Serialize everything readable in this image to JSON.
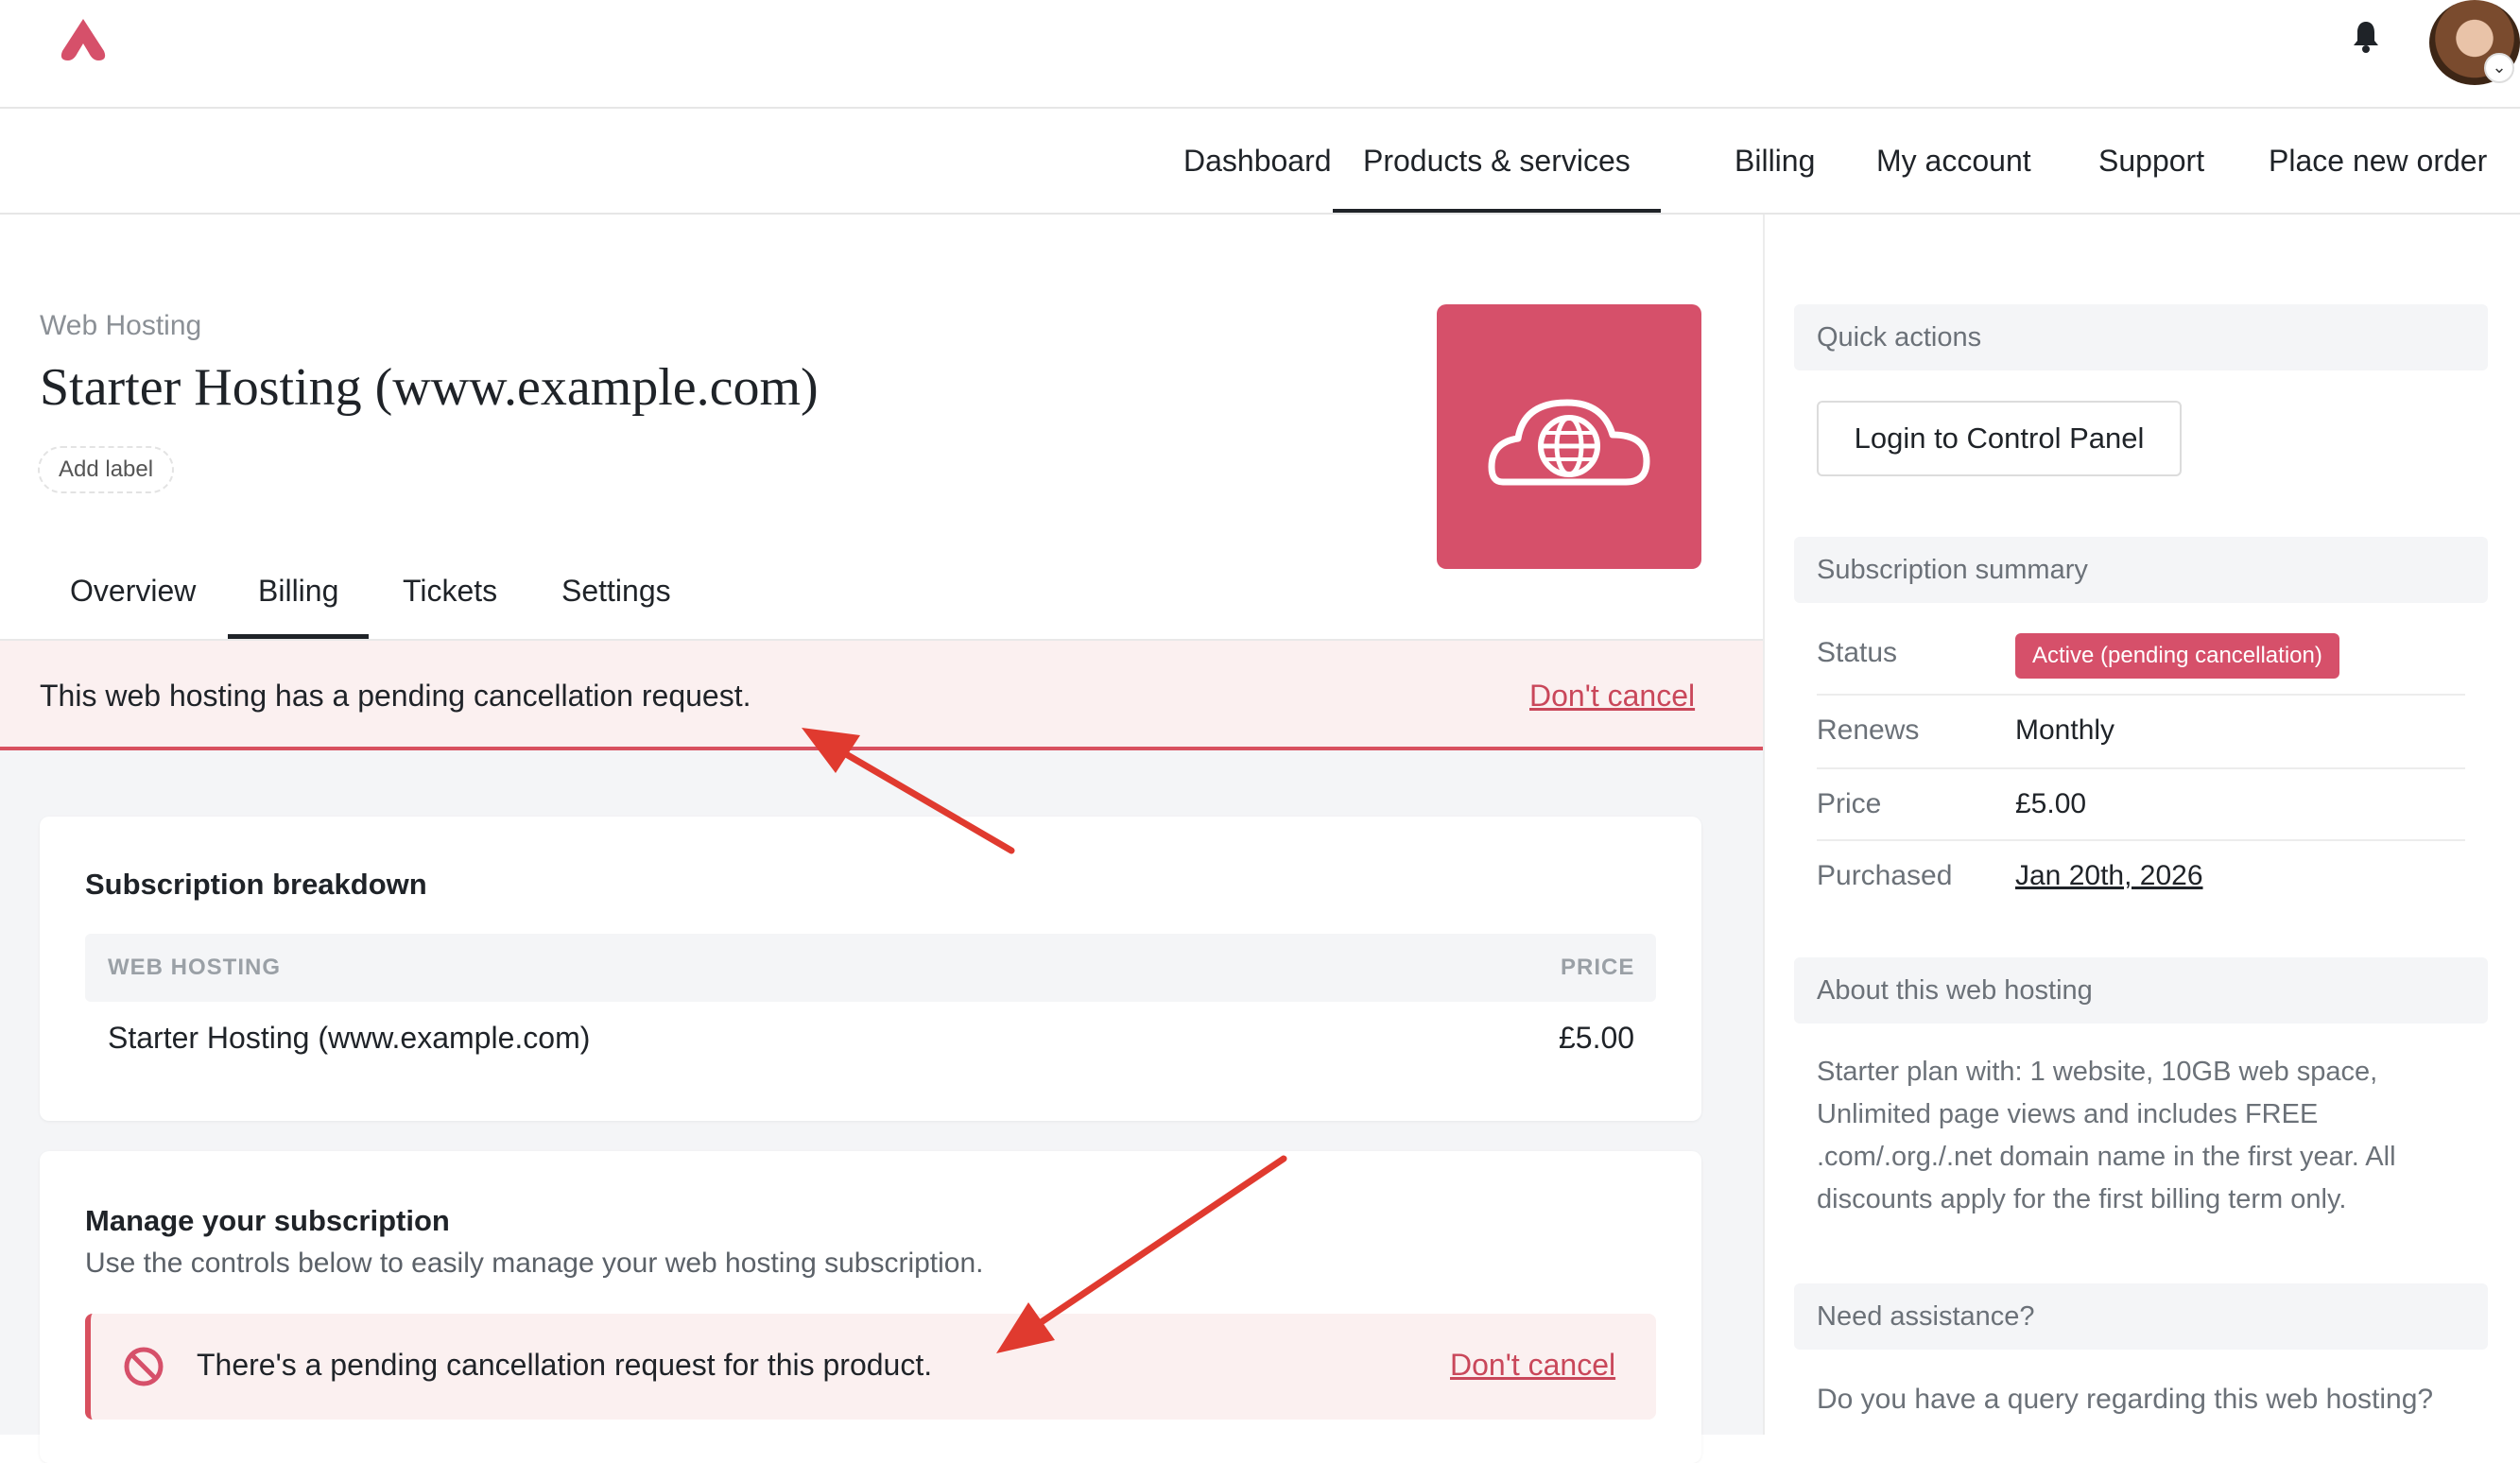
{
  "header": {
    "logo_icon": "brand-logo-icon",
    "notification_icon": "bell-icon",
    "avatar_icon": "user-avatar",
    "avatar_caret": "⌄"
  },
  "nav": {
    "items": [
      {
        "label": "Dashboard"
      },
      {
        "label": "Products & services"
      },
      {
        "label": "Billing"
      },
      {
        "label": "My account"
      },
      {
        "label": "Support"
      },
      {
        "label": "Place new order"
      }
    ],
    "active": "Products & services"
  },
  "product": {
    "category": "Web Hosting",
    "title": "Starter Hosting (www.example.com)",
    "add_label": "Add label",
    "tile_icon": "cloud-globe-icon",
    "tile_color": "#d6506a"
  },
  "tabs": {
    "items": [
      {
        "label": "Overview"
      },
      {
        "label": "Billing"
      },
      {
        "label": "Tickets"
      },
      {
        "label": "Settings"
      }
    ],
    "active": "Billing"
  },
  "banner": {
    "text": "This web hosting has a pending cancellation request.",
    "action": "Don't cancel"
  },
  "breakdown": {
    "title": "Subscription breakdown",
    "columns": [
      "WEB HOSTING",
      "PRICE"
    ],
    "rows": [
      {
        "item": "Starter Hosting (www.example.com)",
        "price": "£5.00"
      }
    ]
  },
  "manage": {
    "title": "Manage your subscription",
    "subtitle": "Use the controls below to easily manage your web hosting subscription.",
    "notice_icon": "ban-icon",
    "notice_text": "There's a pending cancellation request for this product.",
    "notice_action": "Don't cancel"
  },
  "sidebar": {
    "quick_actions": {
      "title": "Quick actions",
      "login_button": "Login to Control Panel"
    },
    "summary": {
      "title": "Subscription summary",
      "status_label": "Status",
      "status_value": "Active (pending cancellation)",
      "renews_label": "Renews",
      "renews_value": "Monthly",
      "price_label": "Price",
      "price_value": "£5.00",
      "purchased_label": "Purchased",
      "purchased_value": "Jan 20th, 2026"
    },
    "about": {
      "title": "About this web hosting",
      "text": "Starter plan with: 1 website, 10GB web space, Unlimited page views and includes FREE .com/.org./.net domain name in the first year. All discounts apply for the first billing term only."
    },
    "assist": {
      "title": "Need assistance?",
      "text": "Do you have a query regarding this web hosting?"
    }
  },
  "colors": {
    "accent": "#d6506a",
    "link": "#c9475a",
    "alert_bg": "#fbf0f0",
    "annotation": "#e03a2f"
  }
}
